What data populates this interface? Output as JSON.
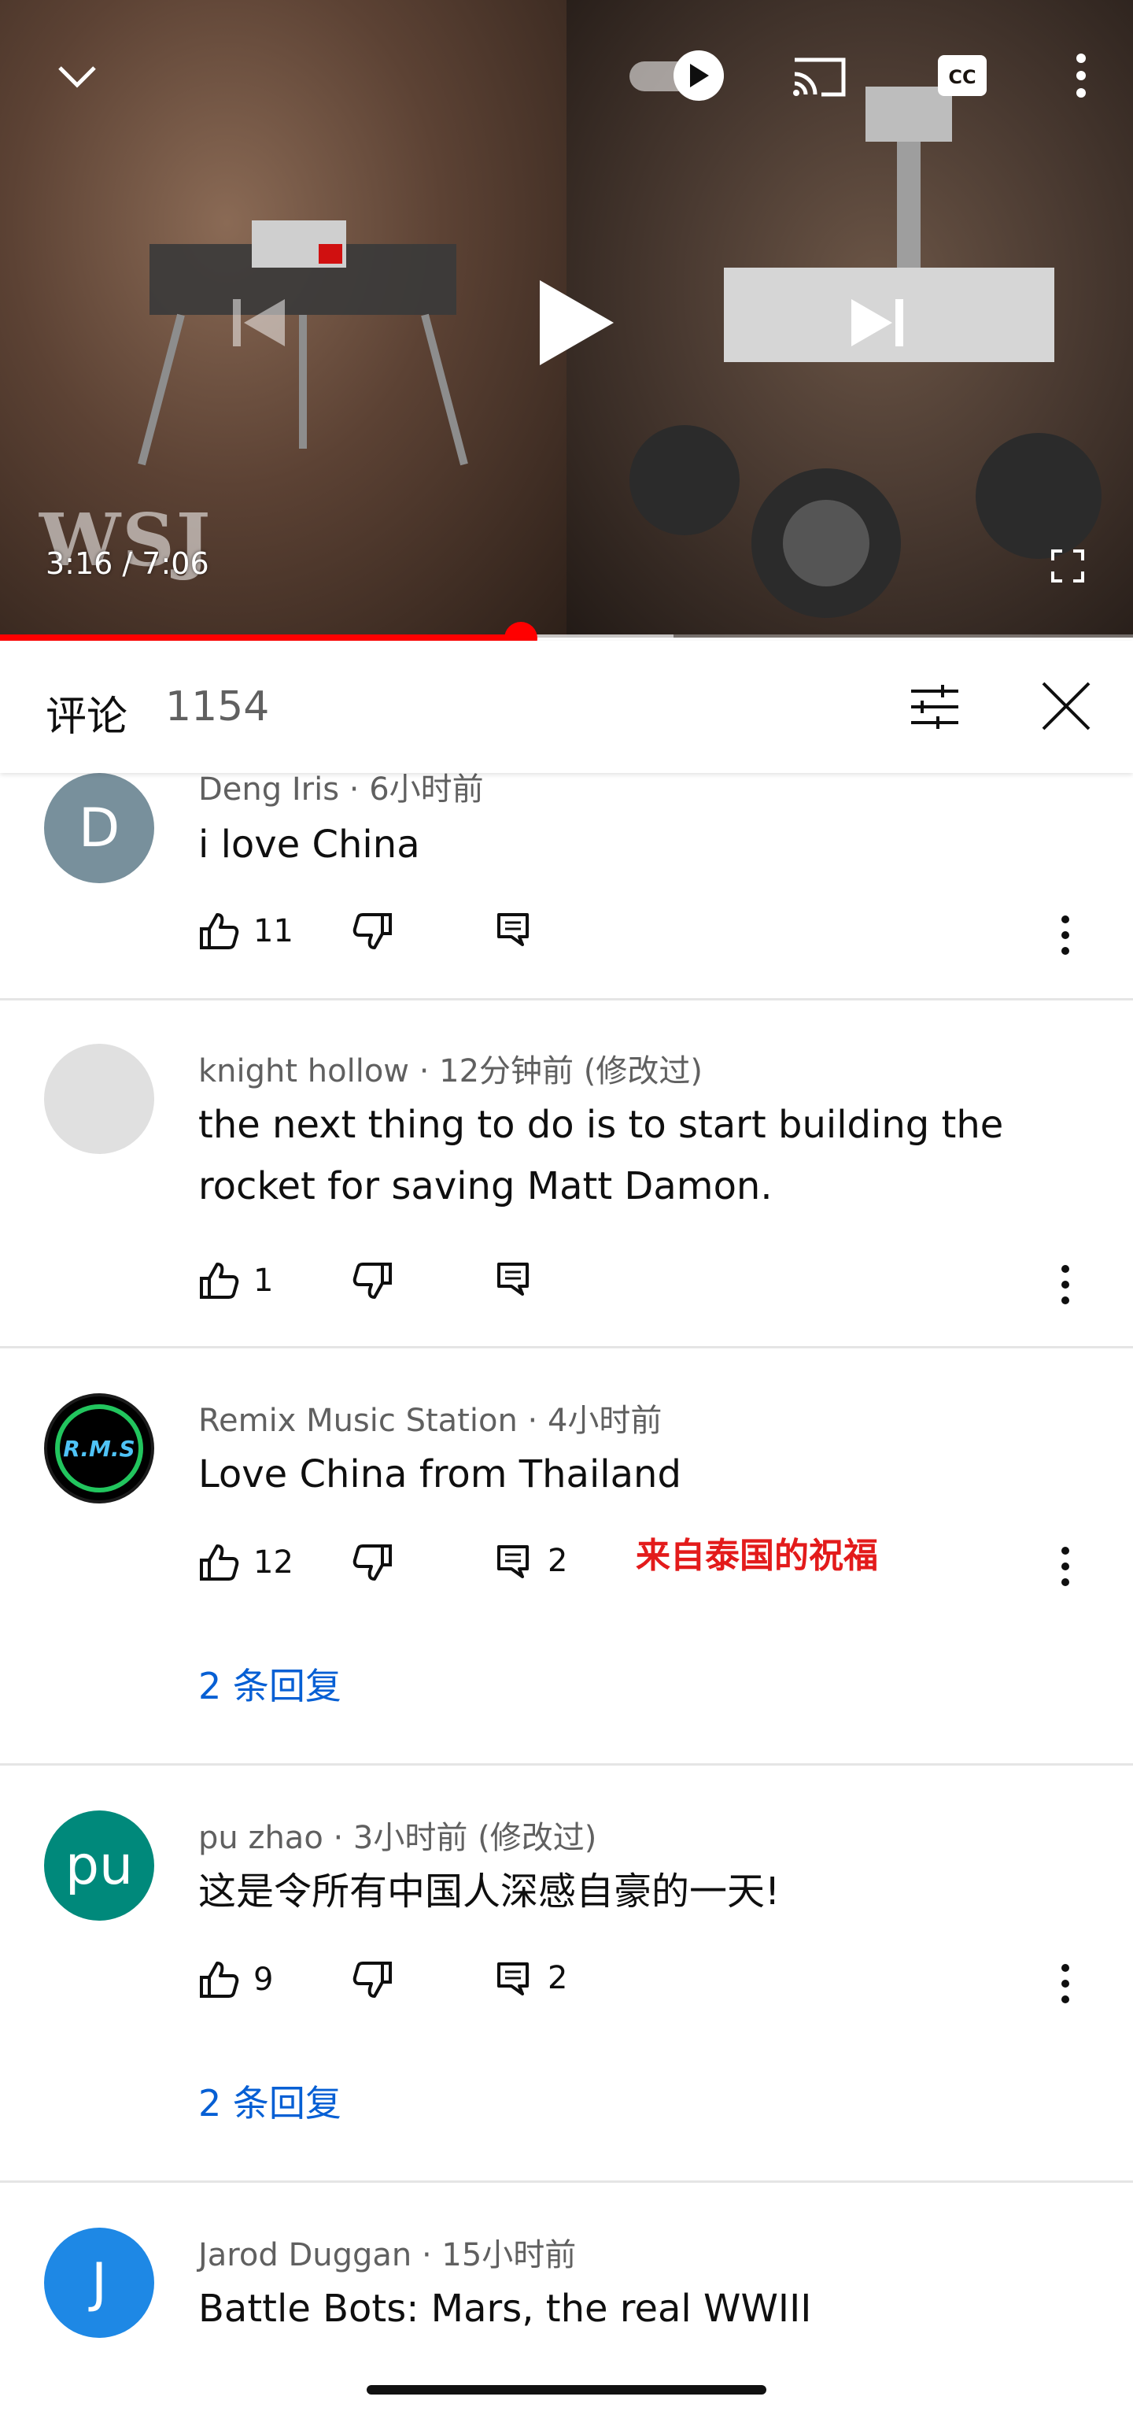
{
  "player": {
    "time_current": "3:16",
    "time_total": "7:06",
    "time_display": "3:16 / 7:06",
    "watermark": "WSJ",
    "progress": 0.46,
    "buffered": 0.595,
    "autoplay_on": true,
    "icons": [
      "chevron-down-icon",
      "autoplay-toggle-icon",
      "cast-icon",
      "captions-icon",
      "more-vert-icon",
      "previous-icon",
      "play-icon",
      "next-icon",
      "fullscreen-icon"
    ]
  },
  "comments_header": {
    "title": "评论",
    "count": "1154"
  },
  "comments": [
    {
      "avatar_letter": "D",
      "avatar_color": "#78909c",
      "author": "Deng Iris",
      "time": "6小时前",
      "meta": "Deng Iris · 6小时前",
      "text": "i love China",
      "likes": "11",
      "replies_count": ""
    },
    {
      "avatar_letter": "",
      "avatar_color": "#e0e0e0",
      "author": "knight hollow",
      "time": "12分钟前 (修改过)",
      "meta": "knight hollow · 12分钟前 (修改过)",
      "text": "the next thing to do is to start building the rocket for saving Matt Damon.",
      "likes": "1",
      "replies_count": ""
    },
    {
      "avatar_letter": "R.M.S",
      "avatar_color": "#000000",
      "author": "Remix Music Station",
      "time": "4小时前",
      "meta": "Remix Music Station · 4小时前",
      "text": "Love China from Thailand",
      "likes": "12",
      "replies_count": "2",
      "replies_link": "2 条回复",
      "annotation": "来自泰国的祝福"
    },
    {
      "avatar_letter": "pu",
      "avatar_color": "#00897b",
      "author": "pu zhao",
      "time": "3小时前 (修改过)",
      "meta": "pu zhao · 3小时前 (修改过)",
      "text": "这是令所有中国人深感自豪的一天!",
      "likes": "9",
      "replies_count": "2",
      "replies_link": "2 条回复"
    },
    {
      "avatar_letter": "J",
      "avatar_color": "#1e88e5",
      "author": "Jarod Duggan",
      "time": "15小时前",
      "meta": "Jarod Duggan · 15小时前",
      "text": "Battle Bots: Mars, the real WWIII"
    }
  ]
}
